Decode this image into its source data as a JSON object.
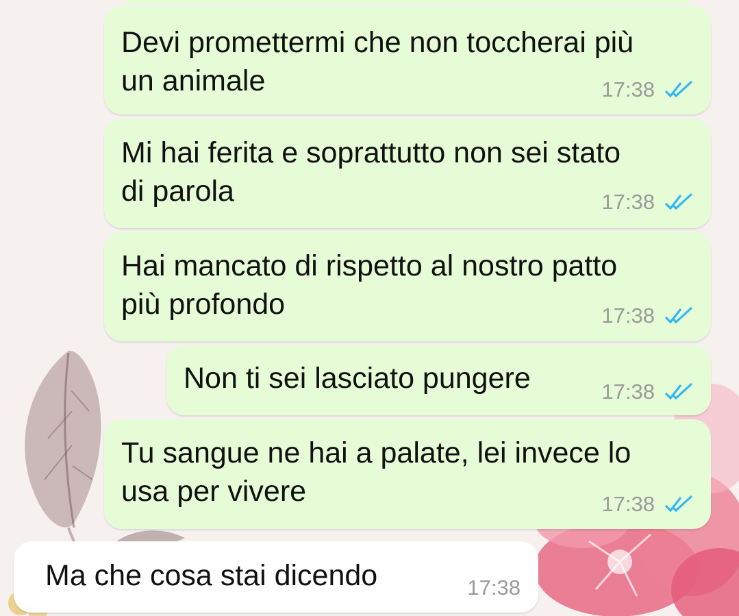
{
  "colors": {
    "outgoing_bubble": "#e5fcd7",
    "incoming_bubble": "#ffffff",
    "read_ticks": "#34b7f1",
    "timestamp": "#9a9a9a"
  },
  "messages": [
    {
      "direction": "outgoing",
      "text": "Devi promettermi che non toccherai più\nun animale",
      "time": "17:38",
      "status": "double-check-read-icon"
    },
    {
      "direction": "outgoing",
      "text": "Mi hai ferita e soprattutto non sei stato\ndi parola",
      "time": "17:38",
      "status": "double-check-read-icon"
    },
    {
      "direction": "outgoing",
      "text": "Hai mancato di rispetto al nostro patto\npiù profondo",
      "time": "17:38",
      "status": "double-check-read-icon"
    },
    {
      "direction": "outgoing",
      "text": "Non ti sei lasciato pungere",
      "time": "17:38",
      "status": "double-check-read-icon"
    },
    {
      "direction": "outgoing",
      "text": "Tu sangue ne hai a palate, lei invece lo\nusa per vivere",
      "time": "17:38",
      "status": "double-check-read-icon"
    },
    {
      "direction": "incoming",
      "text": "Ma che cosa stai dicendo",
      "time": "17:38"
    }
  ]
}
